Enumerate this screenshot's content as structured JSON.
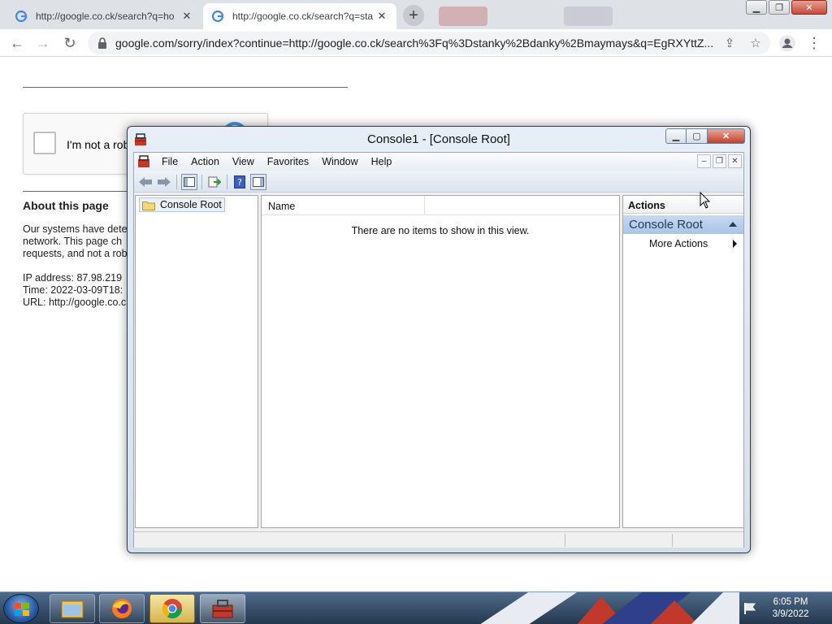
{
  "browser": {
    "tabs": [
      {
        "label": "http://google.co.ck/search?q=ho",
        "active": false
      },
      {
        "label": "http://google.co.ck/search?q=sta",
        "active": true
      }
    ],
    "new_tab_label": "+",
    "address": "google.com/sorry/index?continue=http://google.co.ck/search%3Fq%3Dstanky%2Bdanky%2Bmaymays&q=EgRXYttZ...",
    "icons": [
      "google-favicon",
      "back-arrow",
      "forward-arrow",
      "reload",
      "lock",
      "share",
      "star",
      "profile",
      "menu-kebab"
    ]
  },
  "google_page": {
    "captcha_label": "I'm not a rob",
    "about_title": "About this page",
    "about_lines": [
      "Our systems have dete",
      "network. This page ch",
      "requests, and not a rob"
    ],
    "ip_line": "IP address: 87.98.219",
    "time_line": "Time: 2022-03-09T18:",
    "url_line": "URL: http://google.co.c"
  },
  "mmc": {
    "title": "Console1 - [Console Root]",
    "menu": [
      "File",
      "Action",
      "View",
      "Favorites",
      "Window",
      "Help"
    ],
    "tree_root": "Console Root",
    "column_name": "Name",
    "empty_message": "There are no items to show in this view.",
    "actions_header": "Actions",
    "actions_section": "Console Root",
    "more_actions": "More Actions"
  },
  "taskbar": {
    "apps": [
      "windows-explorer",
      "firefox",
      "chrome",
      "mmc-toolbox"
    ],
    "time": "6:05 PM",
    "date": "3/9/2022"
  }
}
